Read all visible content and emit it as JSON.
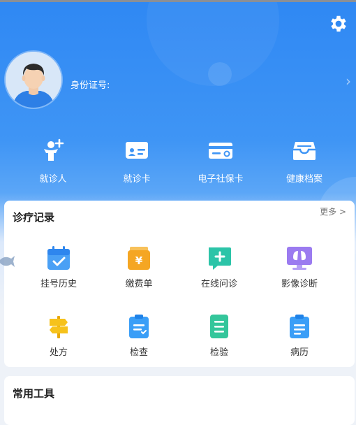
{
  "profile": {
    "id_label": "身份证号:"
  },
  "quick_actions": [
    {
      "label": "就诊人",
      "icon": "add-person-icon"
    },
    {
      "label": "就诊卡",
      "icon": "id-card-icon"
    },
    {
      "label": "电子社保卡",
      "icon": "social-security-card-icon"
    },
    {
      "label": "健康档案",
      "icon": "archive-box-icon"
    }
  ],
  "records": {
    "title": "诊疗记录",
    "more_label": "更多 >",
    "items": [
      {
        "label": "挂号历史",
        "icon": "calendar-check-icon",
        "color": "#4aa0f5"
      },
      {
        "label": "缴费单",
        "icon": "payment-icon",
        "color": "#f5a623"
      },
      {
        "label": "在线问诊",
        "icon": "chat-plus-icon",
        "color": "#2cc4a8"
      },
      {
        "label": "影像诊断",
        "icon": "lung-monitor-icon",
        "color": "#9b7bf0"
      },
      {
        "label": "处方",
        "icon": "signpost-icon",
        "color": "#f6c21c"
      },
      {
        "label": "检查",
        "icon": "checklist-clipboard-icon",
        "color": "#3a9ef7"
      },
      {
        "label": "检验",
        "icon": "lab-report-icon",
        "color": "#34c69b"
      },
      {
        "label": "病历",
        "icon": "medical-record-icon",
        "color": "#3a9ef7"
      }
    ]
  },
  "tools": {
    "title": "常用工具"
  }
}
